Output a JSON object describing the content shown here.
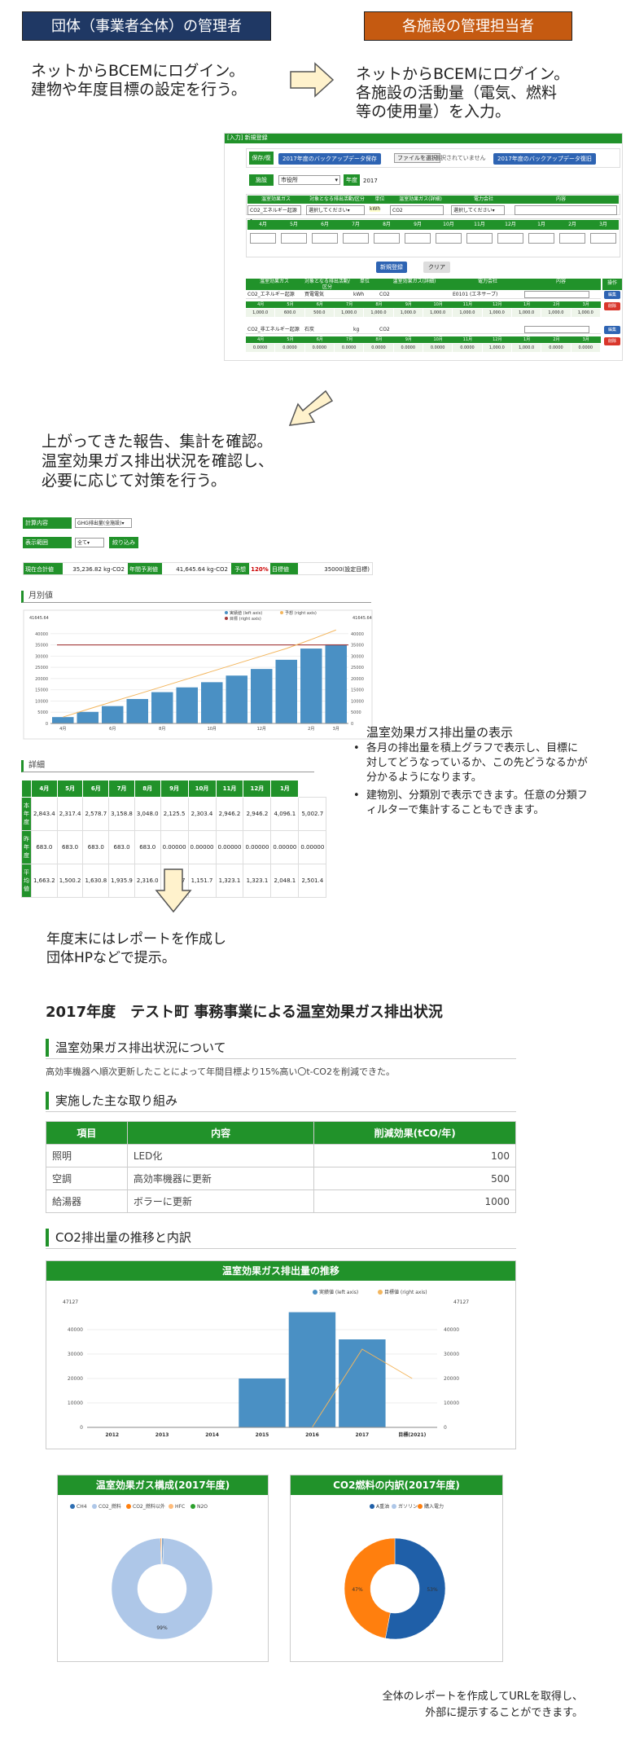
{
  "roles": {
    "org": "団体（事業者全体）の管理者",
    "facility": "各施設の管理担当者"
  },
  "steps": {
    "org_login": [
      "ネットからBCEMにログイン。",
      "建物や年度目標の設定を行う。"
    ],
    "facility_login": [
      "ネットからBCEMにログイン。",
      "各施設の活動量（電気、燃料",
      "等の使用量）を入力。"
    ],
    "review": [
      "上がってきた報告、集計を確認。",
      "温室効果ガス排出状況を確認し、",
      "必要に応じて対策を行う。"
    ],
    "year_end": [
      "年度末にはレポートを作成し",
      "団体HPなどで提示。"
    ],
    "footer": [
      "全体のレポートを作成してURLを取得し、",
      "外部に提示することができます。"
    ]
  },
  "input_screen": {
    "title": "[入力] 新規登録",
    "save_label": "保存/復旧",
    "backup_btn": "2017年度のバックアップデータ保存",
    "file_btn": "ファイルを選択",
    "file_status": "選択されていません",
    "restore_btn": "2017年度のバックアップデータ復旧",
    "facility_label": "施設",
    "facility_value": "市役所",
    "year_label": "年度",
    "year_value": "2017",
    "header_cols": [
      "温室効果ガス",
      "対象となる排出活動/区分",
      "単位",
      "温室効果ガス(詳細)",
      "電力会社",
      "内容"
    ],
    "select_gas": "CO2_エネルギー起源",
    "select_activity": "選択してください",
    "unit": "kWh",
    "select_detail": "CO2",
    "select_company": "選択してください",
    "months": [
      "4月",
      "5月",
      "6月",
      "7月",
      "8月",
      "9月",
      "10月",
      "11月",
      "12月",
      "1月",
      "2月",
      "3月"
    ],
    "register_btn": "新規登録",
    "clear_btn": "クリア",
    "list_cols": [
      "温室効果ガス",
      "対象となる排出活動/区分",
      "単位",
      "温室効果ガス(詳細)",
      "電力会社",
      "内容",
      "操作"
    ],
    "rows": [
      {
        "gas": "CO2_エネルギー起源",
        "activity": "買電電気",
        "unit": "kWh",
        "detail": "CO2",
        "company": "E0101 (エネサーブ)",
        "values": [
          "1,000.0",
          "600.0",
          "500.0",
          "1,000.0",
          "1,000.0",
          "1,000.0",
          "1,000.0",
          "1,000.0",
          "1,000.0",
          "1,000.0",
          "1,000.0",
          "1,000.0"
        ]
      },
      {
        "gas": "CO2_非エネルギー起源",
        "activity": "石炭",
        "unit": "kg",
        "detail": "CO2",
        "company": "",
        "values": [
          "0.0000",
          "0.0000",
          "0.0000",
          "0.0000",
          "0.0000",
          "0.0000",
          "0.0000",
          "0.0000",
          "1,000.0",
          "1,000.0",
          "0.0000",
          "0.0000"
        ]
      }
    ],
    "edit_label": "編集",
    "delete_label": "削除"
  },
  "dashboard": {
    "calc_label": "計算内容",
    "calc_value": "GHG排出量(全施設)",
    "range_label": "表示範囲",
    "range_value": "全て",
    "filter_btn": "絞り込み",
    "current_label": "現在合計値",
    "current_value": "35,236.82 kg-CO2",
    "forecast_label": "年間予測値",
    "forecast_value": "41,645.64 kg-CO2",
    "forecast_pct_label": "予想",
    "forecast_pct": "120%",
    "target_label": "目標値",
    "target_value": "35000(設定目標)",
    "monthly_title": "月別値",
    "detail_title": "詳細"
  },
  "monthly_chart": {
    "type": "bar",
    "categories": [
      "4月",
      "5月",
      "6月",
      "7月",
      "8月",
      "9月",
      "10月",
      "11月",
      "12月",
      "1月",
      "2月",
      "3月"
    ],
    "series": [
      {
        "name": "実績値 (left axis)",
        "values": [
          2843,
          5160,
          7739,
          10898,
          13946,
          16072,
          18375,
          21321,
          24267,
          28364,
          33366,
          35237
        ]
      }
    ],
    "forecast_line": [
      2843,
      6300,
      9700,
      13000,
      16400,
      19800,
      23200,
      26600,
      30000,
      33400,
      37400,
      41646
    ],
    "target": 35000,
    "ylim": [
      0,
      45000
    ],
    "legend": [
      "実績値 (left axis)",
      "予想 (right axis)",
      "目標 (right axis)"
    ],
    "left_top_label": "41645.64",
    "right_top_label": "41645.64",
    "y_ticks": [
      "40000",
      "35000",
      "30000",
      "25000",
      "20000",
      "15000",
      "10000",
      "5000",
      "0"
    ],
    "x_tick_labels": [
      "4月",
      "5月",
      "6月",
      "7月",
      "8月",
      "9月",
      "10月",
      "11月",
      "12月",
      "1月",
      "2月",
      "3月"
    ],
    "colors": {
      "bar": "#4a90c4",
      "forecast": "#f3b65e",
      "target": "#a33a3a"
    }
  },
  "detail_table": {
    "headers": [
      "",
      "4月",
      "5月",
      "6月",
      "7月",
      "8月",
      "9月",
      "10月",
      "11月",
      "12月",
      "1月"
    ],
    "rows": [
      {
        "label": "本年度",
        "values": [
          "2,843.4",
          "2,317.4",
          "2,578.7",
          "3,158.8",
          "3,048.0",
          "2,125.5",
          "2,303.4",
          "2,946.2",
          "2,946.2",
          "4,096.1",
          "5,002.7"
        ]
      },
      {
        "label": "昨年度",
        "values": [
          "683.0",
          "683.0",
          "683.0",
          "683.0",
          "683.0",
          "0.00000",
          "0.00000",
          "0.00000",
          "0.00000",
          "0.00000",
          "0.00000"
        ]
      },
      {
        "label": "平均値",
        "values": [
          "1,663.2",
          "1,500.2",
          "1,630.8",
          "1,935.9",
          "2,316.0",
          "1,062.7",
          "1,151.7",
          "1,323.1",
          "1,323.1",
          "2,048.1",
          "2,501.4"
        ]
      }
    ]
  },
  "ghg_notes": {
    "title": "温室効果ガス排出量の表示",
    "bullets": [
      "各月の排出量を積上グラフで表示し、目標に対してどうなっているか、この先どうなるかが分かるようになります。",
      "建物別、分類別で表示できます。任意の分類フィルターで集計することもできます。"
    ]
  },
  "report": {
    "title": "2017年度　テスト町 事務事業による温室効果ガス排出状況",
    "section1_title": "温室効果ガス排出状況について",
    "section1_text": "高効率機器へ順次更新したことによって年間目標より15%高い〇t-CO2を削減できた。",
    "section2_title": "実施した主な取り組み",
    "actions_headers": [
      "項目",
      "内容",
      "削減効果(tCO/年)"
    ],
    "actions": [
      {
        "item": "照明",
        "content": "LED化",
        "effect": "100"
      },
      {
        "item": "空調",
        "content": "高効率機器に更新",
        "effect": "500"
      },
      {
        "item": "給湯器",
        "content": "ボラーに更新",
        "effect": "1000"
      }
    ],
    "section3_title": "CO2排出量の推移と内訳"
  },
  "trend_chart": {
    "type": "bar",
    "title": "温室効果ガス排出量の推移",
    "categories": [
      "2012",
      "2013",
      "2014",
      "2015",
      "2016",
      "2017",
      "目標(2021)"
    ],
    "series": [
      {
        "name": "実績値 (left axis)",
        "values": [
          0,
          0,
          0,
          20000,
          47127,
          36000,
          0
        ]
      }
    ],
    "line": [
      0,
      0,
      0,
      0,
      0,
      32000,
      20000
    ],
    "legend": [
      "実績値 (left axis)",
      "目標値 (right axis)"
    ],
    "top_label": "47127",
    "y_ticks": [
      "40000",
      "30000",
      "20000",
      "10000",
      "0"
    ],
    "ylim": [
      0,
      50000
    ],
    "colors": {
      "bar": "#4a90c4",
      "line": "#f3b65e"
    }
  },
  "pie_charts": [
    {
      "type": "pie",
      "title": "温室効果ガス構成(2017年度)",
      "legend": [
        "CH4",
        "CO2_燃料",
        "CO2_燃料以外",
        "HFC",
        "N2O"
      ],
      "colors": [
        "#2e6fb3",
        "#aec7e8",
        "#ff7f0e",
        "#ffbb78",
        "#2ca02c"
      ],
      "values": [
        0.5,
        99,
        0.3,
        0.2,
        0.0
      ],
      "label": "99%"
    },
    {
      "type": "pie",
      "title": "CO2燃料の内訳(2017年度)",
      "legend": [
        "A重油",
        "ガソリン",
        "購入電力"
      ],
      "colors": [
        "#1f5fa8",
        "#aec7e8",
        "#ff7f0e"
      ],
      "values": [
        53,
        0,
        47
      ],
      "labels": [
        "53%",
        "47%"
      ]
    }
  ]
}
